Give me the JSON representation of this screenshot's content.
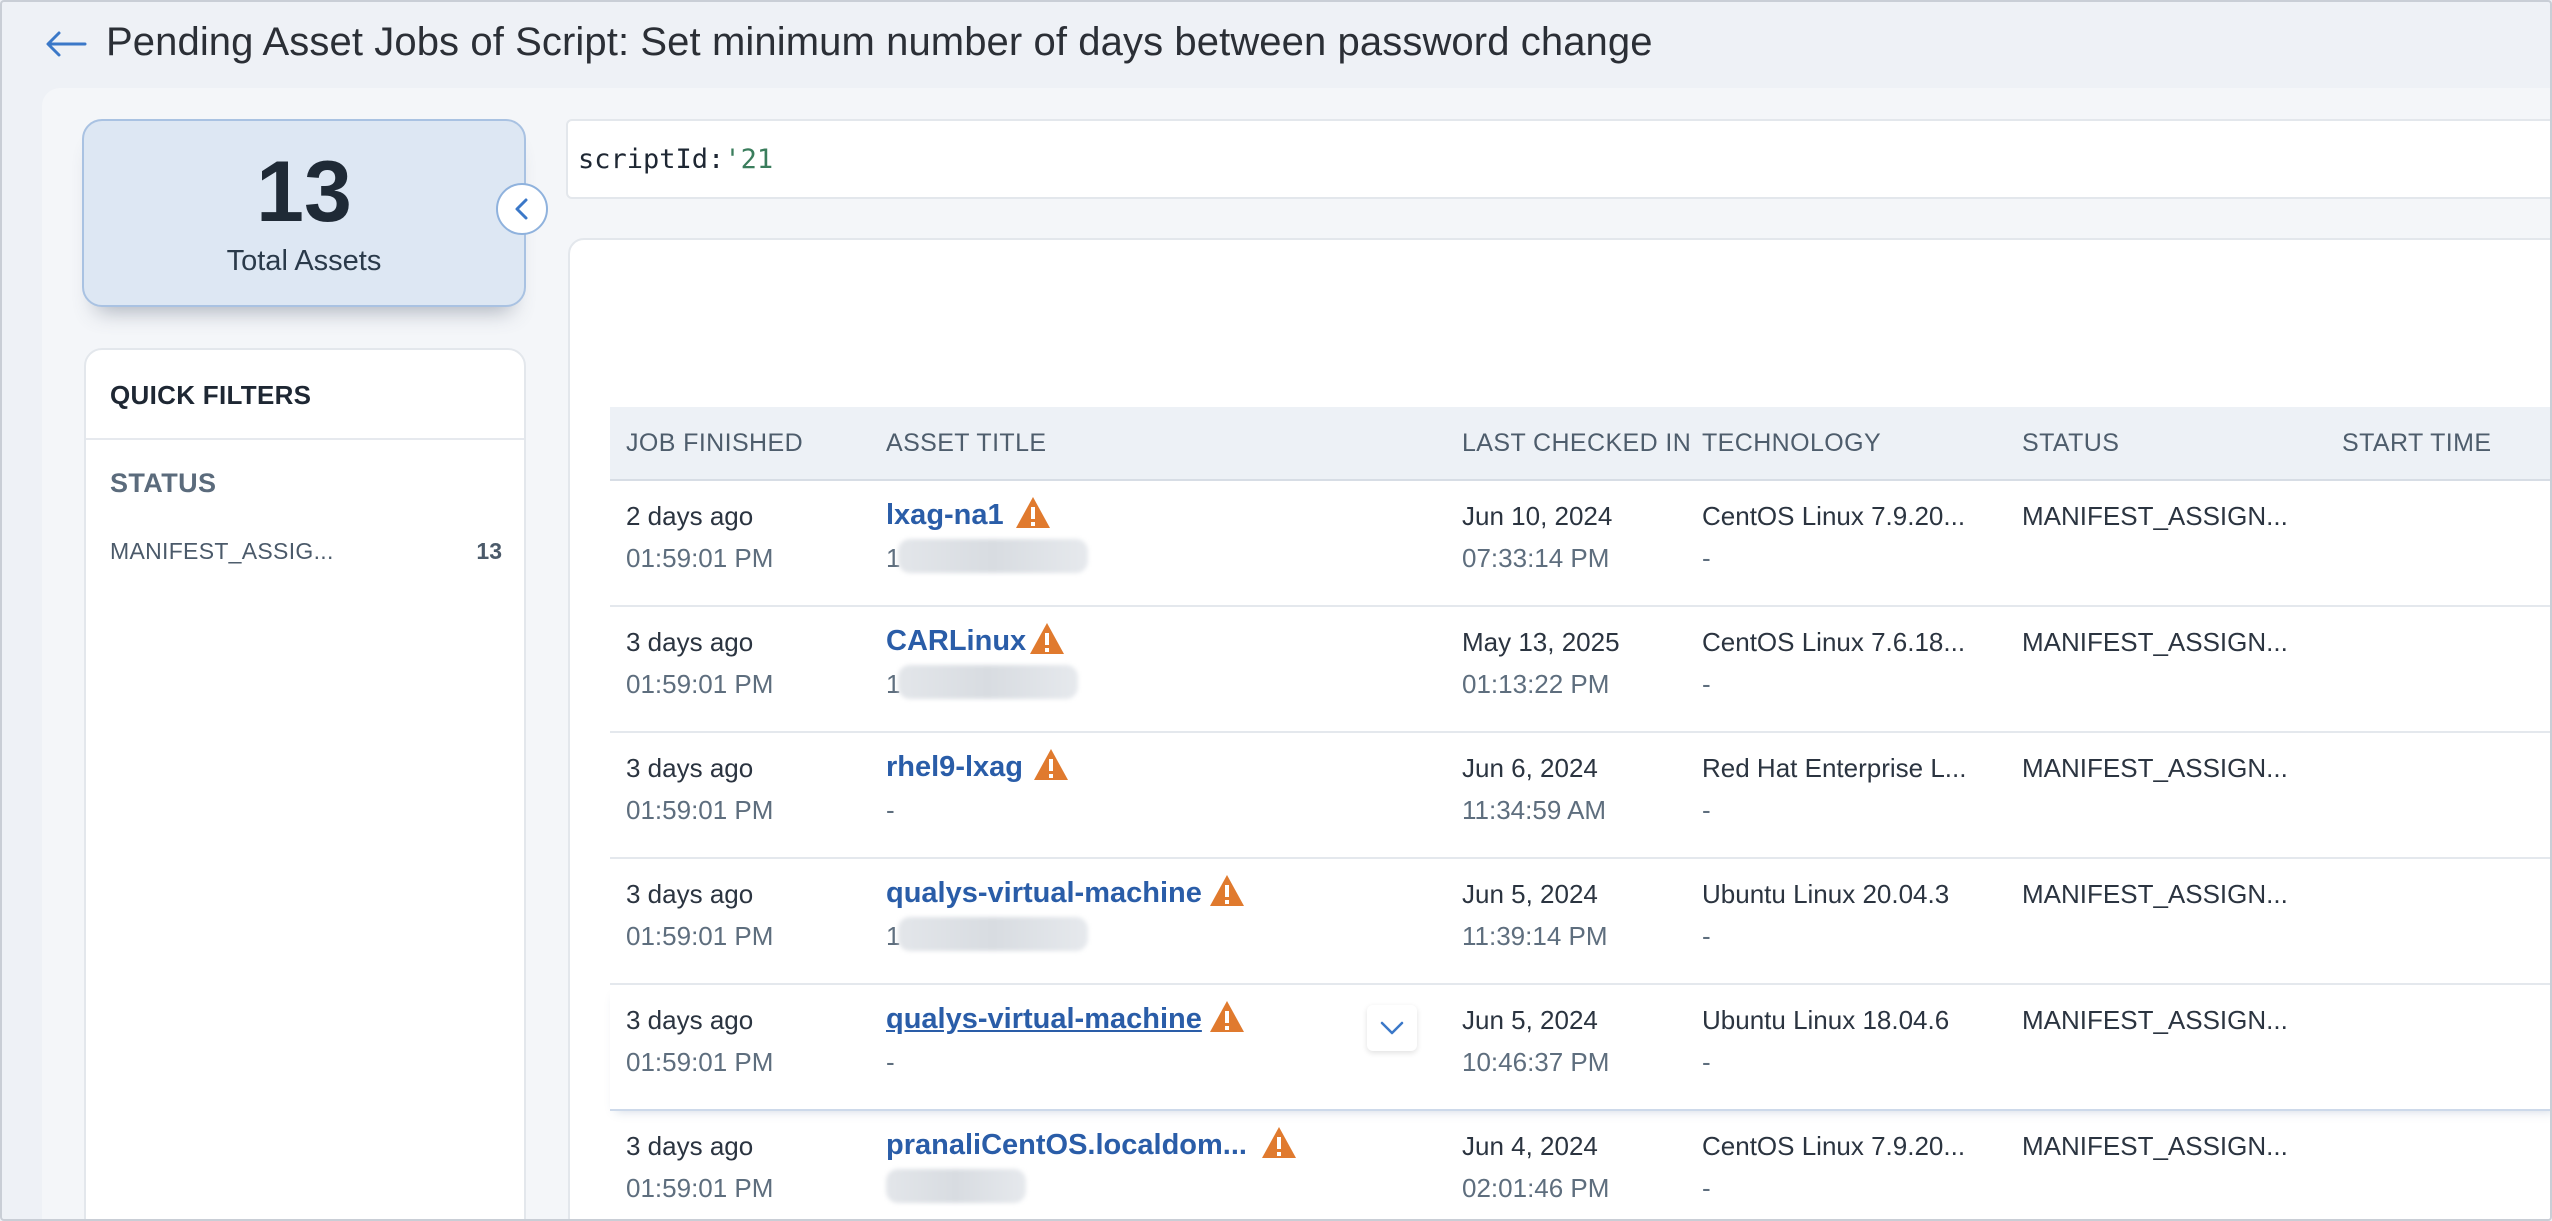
{
  "header": {
    "title": "Pending Asset Jobs of Script: Set minimum number of days between password change"
  },
  "summary": {
    "count": "13",
    "label": "Total Assets"
  },
  "quick_filters": {
    "title": "QUICK FILTERS",
    "status_heading": "STATUS",
    "items": [
      {
        "label": "MANIFEST_ASSIG...",
        "count": "13"
      }
    ]
  },
  "search": {
    "query_key": "scriptId:",
    "query_value": "'21"
  },
  "table": {
    "columns": [
      "JOB FINISHED",
      "ASSET TITLE",
      "LAST CHECKED IN",
      "TECHNOLOGY",
      "STATUS",
      "START TIME"
    ],
    "rows": [
      {
        "job_finished": "2 days ago",
        "job_time": "01:59:01 PM",
        "asset_title": "lxag-na1",
        "asset_sub": "1",
        "last_checked": "Jun 10, 2024",
        "last_checked_time": "07:33:14 PM",
        "technology": "CentOS Linux 7.9.20...",
        "technology_sub": "-",
        "status": "MANIFEST_ASSIGN..."
      },
      {
        "job_finished": "3 days ago",
        "job_time": "01:59:01 PM",
        "asset_title": "CARLinux",
        "asset_sub": "1",
        "last_checked": "May 13, 2025",
        "last_checked_time": "01:13:22 PM",
        "technology": "CentOS Linux 7.6.18...",
        "technology_sub": "-",
        "status": "MANIFEST_ASSIGN..."
      },
      {
        "job_finished": "3 days ago",
        "job_time": "01:59:01 PM",
        "asset_title": "rhel9-lxag",
        "asset_sub": "-",
        "last_checked": "Jun 6, 2024",
        "last_checked_time": "11:34:59 AM",
        "technology": "Red Hat Enterprise L...",
        "technology_sub": "-",
        "status": "MANIFEST_ASSIGN..."
      },
      {
        "job_finished": "3 days ago",
        "job_time": "01:59:01 PM",
        "asset_title": "qualys-virtual-machine",
        "asset_sub": "1",
        "last_checked": "Jun 5, 2024",
        "last_checked_time": "11:39:14 PM",
        "technology": "Ubuntu Linux 20.04.3",
        "technology_sub": "-",
        "status": "MANIFEST_ASSIGN..."
      },
      {
        "job_finished": "3 days ago",
        "job_time": "01:59:01 PM",
        "asset_title": "qualys-virtual-machine",
        "asset_sub": "-",
        "last_checked": "Jun 5, 2024",
        "last_checked_time": "10:46:37 PM",
        "technology": "Ubuntu Linux 18.04.6",
        "technology_sub": "-",
        "status": "MANIFEST_ASSIGN..."
      },
      {
        "job_finished": "3 days ago",
        "job_time": "01:59:01 PM",
        "asset_title": "pranaliCentOS.localdom...",
        "asset_sub": "",
        "last_checked": "Jun 4, 2024",
        "last_checked_time": "02:01:46 PM",
        "technology": "CentOS Linux 7.9.20...",
        "technology_sub": "-",
        "status": "MANIFEST_ASSIGN..."
      }
    ]
  },
  "icons": {
    "back": "arrow-left-icon",
    "collapse": "chevron-left-icon",
    "warning": "warning-triangle-icon",
    "expand": "chevron-down-icon"
  },
  "colors": {
    "link": "#2a5da8",
    "warning": "#e07a2e",
    "accent": "#3b78c8"
  }
}
